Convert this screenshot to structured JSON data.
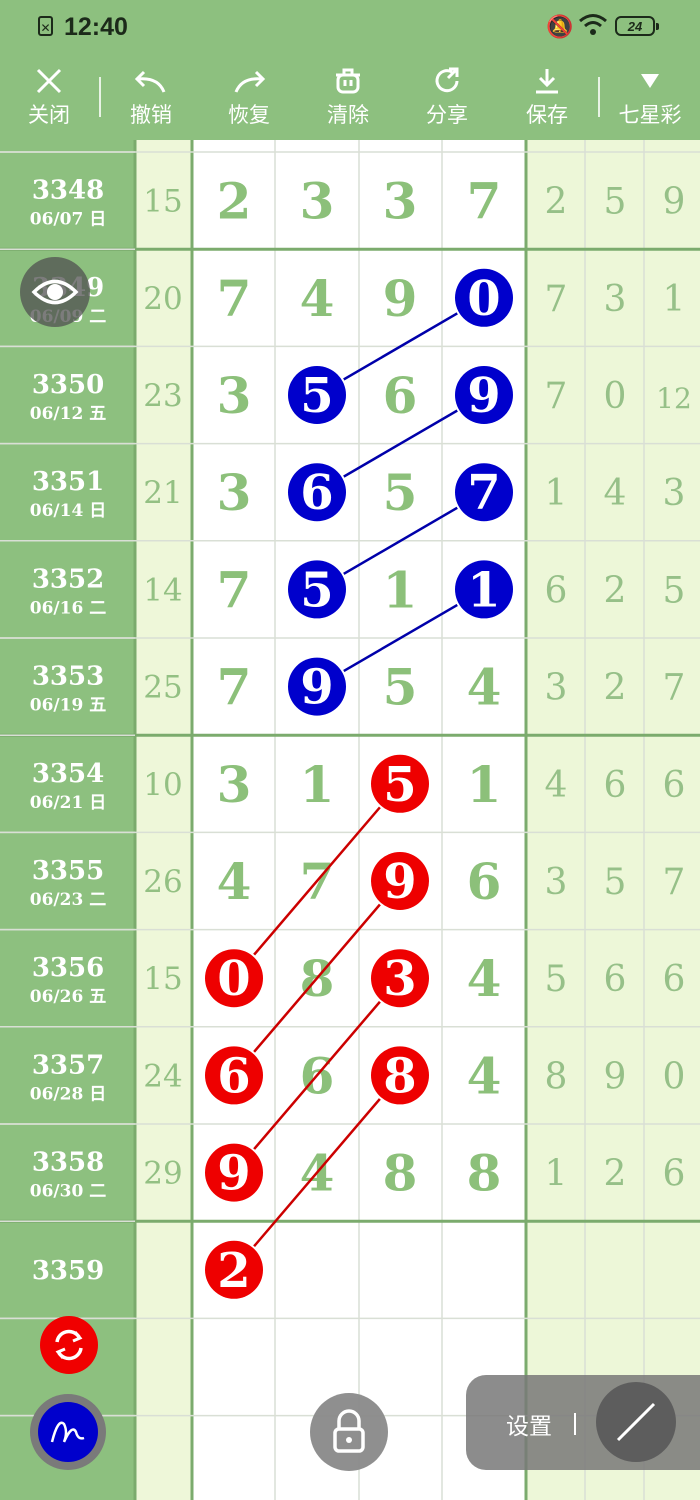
{
  "status_bar": {
    "time": "12:40",
    "battery": "24",
    "sim_icon": "sim-off-icon",
    "bell_icon": "bell-muted-icon",
    "wifi_icon": "wifi-icon"
  },
  "toolbar": {
    "items": [
      {
        "label": "关闭",
        "icon": "close-icon"
      },
      {
        "label": "撤销",
        "icon": "undo-icon"
      },
      {
        "label": "恢复",
        "icon": "redo-icon"
      },
      {
        "label": "清除",
        "icon": "trash-icon"
      },
      {
        "label": "分享",
        "icon": "share-icon"
      },
      {
        "label": "保存",
        "icon": "download-icon"
      },
      {
        "label": "七星彩",
        "icon": "dropdown-triangle-icon"
      }
    ]
  },
  "rows": [
    {
      "period": "3348",
      "date": "06/07 日",
      "sum": "15",
      "main": [
        "2",
        "3",
        "3",
        "7"
      ],
      "right": [
        "2",
        "5",
        "9"
      ]
    },
    {
      "period": "3349",
      "date": "06/09 二",
      "sum": "20",
      "main": [
        "7",
        "4",
        "9",
        "0"
      ],
      "right": [
        "7",
        "3",
        "1"
      ]
    },
    {
      "period": "3350",
      "date": "06/12 五",
      "sum": "23",
      "main": [
        "3",
        "5",
        "6",
        "9"
      ],
      "right": [
        "7",
        "0",
        "12"
      ]
    },
    {
      "period": "3351",
      "date": "06/14 日",
      "sum": "21",
      "main": [
        "3",
        "6",
        "5",
        "7"
      ],
      "right": [
        "1",
        "4",
        "3"
      ]
    },
    {
      "period": "3352",
      "date": "06/16 二",
      "sum": "14",
      "main": [
        "7",
        "5",
        "1",
        "1"
      ],
      "right": [
        "6",
        "2",
        "5"
      ]
    },
    {
      "period": "3353",
      "date": "06/19 五",
      "sum": "25",
      "main": [
        "7",
        "9",
        "5",
        "4"
      ],
      "right": [
        "3",
        "2",
        "7"
      ]
    },
    {
      "period": "3354",
      "date": "06/21 日",
      "sum": "10",
      "main": [
        "3",
        "1",
        "5",
        "1"
      ],
      "right": [
        "4",
        "6",
        "6"
      ]
    },
    {
      "period": "3355",
      "date": "06/23 二",
      "sum": "26",
      "main": [
        "4",
        "7",
        "9",
        "6"
      ],
      "right": [
        "3",
        "5",
        "7"
      ]
    },
    {
      "period": "3356",
      "date": "06/26 五",
      "sum": "15",
      "main": [
        "0",
        "8",
        "3",
        "4"
      ],
      "right": [
        "5",
        "6",
        "6"
      ]
    },
    {
      "period": "3357",
      "date": "06/28 日",
      "sum": "24",
      "main": [
        "6",
        "6",
        "8",
        "4"
      ],
      "right": [
        "8",
        "9",
        "0"
      ]
    },
    {
      "period": "3358",
      "date": "06/30 二",
      "sum": "29",
      "main": [
        "9",
        "4",
        "8",
        "8"
      ],
      "right": [
        "1",
        "2",
        "6"
      ]
    },
    {
      "period": "3359",
      "date": "",
      "sum": "",
      "main": [
        "2",
        "",
        "",
        ""
      ],
      "right": [
        "",
        "",
        ""
      ]
    }
  ],
  "balls": [
    {
      "row": 1,
      "col": 3,
      "color": "#0000cc"
    },
    {
      "row": 2,
      "col": 1,
      "color": "#0000cc"
    },
    {
      "row": 2,
      "col": 3,
      "color": "#0000cc"
    },
    {
      "row": 3,
      "col": 1,
      "color": "#0000cc"
    },
    {
      "row": 3,
      "col": 3,
      "color": "#0000cc"
    },
    {
      "row": 4,
      "col": 1,
      "color": "#0000cc"
    },
    {
      "row": 4,
      "col": 3,
      "color": "#0000cc"
    },
    {
      "row": 5,
      "col": 1,
      "color": "#0000cc"
    },
    {
      "row": 6,
      "col": 2,
      "color": "#ee0000"
    },
    {
      "row": 7,
      "col": 2,
      "color": "#ee0000"
    },
    {
      "row": 8,
      "col": 0,
      "color": "#ee0000"
    },
    {
      "row": 8,
      "col": 2,
      "color": "#ee0000"
    },
    {
      "row": 9,
      "col": 0,
      "color": "#ee0000"
    },
    {
      "row": 9,
      "col": 2,
      "color": "#ee0000"
    },
    {
      "row": 10,
      "col": 0,
      "color": "#ee0000"
    },
    {
      "row": 11,
      "col": 0,
      "color": "#ee0000"
    }
  ],
  "connectors": [
    {
      "from": [
        1,
        3
      ],
      "to": [
        2,
        1
      ],
      "color": "#0000aa"
    },
    {
      "from": [
        2,
        3
      ],
      "to": [
        3,
        1
      ],
      "color": "#0000aa"
    },
    {
      "from": [
        3,
        3
      ],
      "to": [
        4,
        1
      ],
      "color": "#0000aa"
    },
    {
      "from": [
        4,
        3
      ],
      "to": [
        5,
        1
      ],
      "color": "#0000aa"
    },
    {
      "from": [
        6,
        2
      ],
      "to": [
        8,
        0
      ],
      "color": "#cc0000"
    },
    {
      "from": [
        7,
        2
      ],
      "to": [
        9,
        0
      ],
      "color": "#cc0000"
    },
    {
      "from": [
        8,
        2
      ],
      "to": [
        10,
        0
      ],
      "color": "#cc0000"
    },
    {
      "from": [
        9,
        2
      ],
      "to": [
        11,
        0
      ],
      "color": "#cc0000"
    }
  ],
  "controls": {
    "eye_icon": "eye-icon",
    "refresh_icon": "refresh-icon",
    "pen_icon": "pen-scribble-icon",
    "lock_icon": "lock-icon",
    "settings_label": "设置",
    "line_tool_icon": "line-tool-icon"
  },
  "colors": {
    "header_green": "#8dc07f",
    "left_col_green": "#8dc07f",
    "sum_col": "#eef7d9",
    "right_col": "#edf7d8",
    "blue_ball": "#0000cc",
    "red_ball": "#ee0000"
  }
}
